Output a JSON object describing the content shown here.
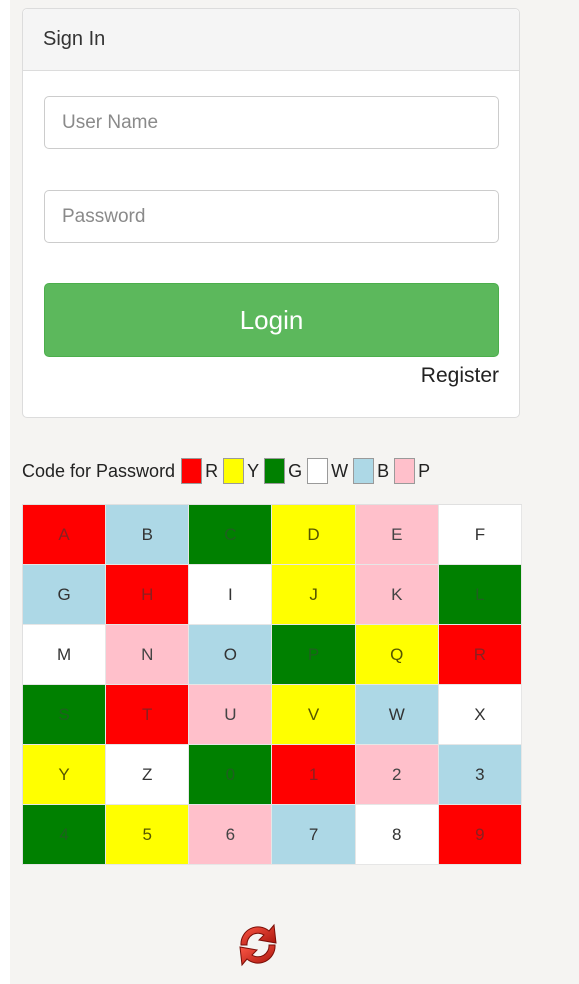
{
  "signin": {
    "title": "Sign In",
    "username_placeholder": "User Name",
    "password_placeholder": "Password",
    "login_label": "Login",
    "register_label": "Register"
  },
  "legend": {
    "caption": "Code for Password",
    "items": [
      {
        "letter": "R",
        "color": "#ff0000"
      },
      {
        "letter": "Y",
        "color": "#ffff00"
      },
      {
        "letter": "G",
        "color": "#008000"
      },
      {
        "letter": "W",
        "color": "#ffffff"
      },
      {
        "letter": "B",
        "color": "#add8e6"
      },
      {
        "letter": "P",
        "color": "#ffc0cb"
      }
    ]
  },
  "code_grid": [
    [
      {
        "char": "A",
        "color": "R"
      },
      {
        "char": "B",
        "color": "B"
      },
      {
        "char": "C",
        "color": "G"
      },
      {
        "char": "D",
        "color": "Y"
      },
      {
        "char": "E",
        "color": "P"
      },
      {
        "char": "F",
        "color": "W"
      }
    ],
    [
      {
        "char": "G",
        "color": "B"
      },
      {
        "char": "H",
        "color": "R"
      },
      {
        "char": "I",
        "color": "W"
      },
      {
        "char": "J",
        "color": "Y"
      },
      {
        "char": "K",
        "color": "P"
      },
      {
        "char": "L",
        "color": "G"
      }
    ],
    [
      {
        "char": "M",
        "color": "W"
      },
      {
        "char": "N",
        "color": "P"
      },
      {
        "char": "O",
        "color": "B"
      },
      {
        "char": "P",
        "color": "G"
      },
      {
        "char": "Q",
        "color": "Y"
      },
      {
        "char": "R",
        "color": "R"
      }
    ],
    [
      {
        "char": "S",
        "color": "G"
      },
      {
        "char": "T",
        "color": "R"
      },
      {
        "char": "U",
        "color": "P"
      },
      {
        "char": "V",
        "color": "Y"
      },
      {
        "char": "W",
        "color": "B"
      },
      {
        "char": "X",
        "color": "W"
      }
    ],
    [
      {
        "char": "Y",
        "color": "Y"
      },
      {
        "char": "Z",
        "color": "W"
      },
      {
        "char": "0",
        "color": "G"
      },
      {
        "char": "1",
        "color": "R"
      },
      {
        "char": "2",
        "color": "P"
      },
      {
        "char": "3",
        "color": "B"
      }
    ],
    [
      {
        "char": "4",
        "color": "G"
      },
      {
        "char": "5",
        "color": "Y"
      },
      {
        "char": "6",
        "color": "P"
      },
      {
        "char": "7",
        "color": "B"
      },
      {
        "char": "8",
        "color": "W"
      },
      {
        "char": "9",
        "color": "R"
      }
    ]
  ],
  "refresh_icon": "refresh-icon",
  "colors": {
    "login_button": "#5cb85c",
    "refresh_icon": "#d42a1e"
  }
}
